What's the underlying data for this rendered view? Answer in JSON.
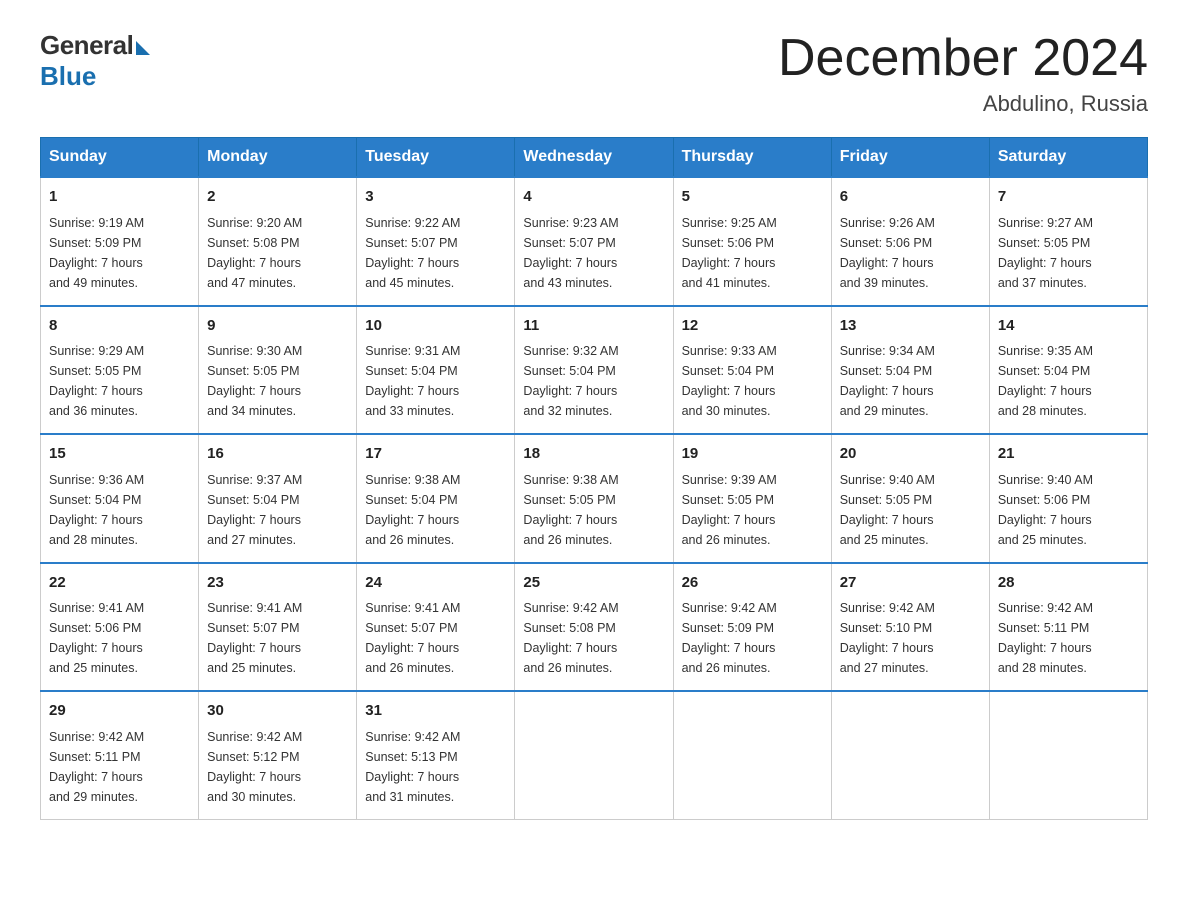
{
  "header": {
    "logo_general": "General",
    "logo_blue": "Blue",
    "month_title": "December 2024",
    "location": "Abdulino, Russia"
  },
  "weekdays": [
    "Sunday",
    "Monday",
    "Tuesday",
    "Wednesday",
    "Thursday",
    "Friday",
    "Saturday"
  ],
  "weeks": [
    [
      {
        "day": "1",
        "sunrise": "9:19 AM",
        "sunset": "5:09 PM",
        "daylight": "7 hours and 49 minutes."
      },
      {
        "day": "2",
        "sunrise": "9:20 AM",
        "sunset": "5:08 PM",
        "daylight": "7 hours and 47 minutes."
      },
      {
        "day": "3",
        "sunrise": "9:22 AM",
        "sunset": "5:07 PM",
        "daylight": "7 hours and 45 minutes."
      },
      {
        "day": "4",
        "sunrise": "9:23 AM",
        "sunset": "5:07 PM",
        "daylight": "7 hours and 43 minutes."
      },
      {
        "day": "5",
        "sunrise": "9:25 AM",
        "sunset": "5:06 PM",
        "daylight": "7 hours and 41 minutes."
      },
      {
        "day": "6",
        "sunrise": "9:26 AM",
        "sunset": "5:06 PM",
        "daylight": "7 hours and 39 minutes."
      },
      {
        "day": "7",
        "sunrise": "9:27 AM",
        "sunset": "5:05 PM",
        "daylight": "7 hours and 37 minutes."
      }
    ],
    [
      {
        "day": "8",
        "sunrise": "9:29 AM",
        "sunset": "5:05 PM",
        "daylight": "7 hours and 36 minutes."
      },
      {
        "day": "9",
        "sunrise": "9:30 AM",
        "sunset": "5:05 PM",
        "daylight": "7 hours and 34 minutes."
      },
      {
        "day": "10",
        "sunrise": "9:31 AM",
        "sunset": "5:04 PM",
        "daylight": "7 hours and 33 minutes."
      },
      {
        "day": "11",
        "sunrise": "9:32 AM",
        "sunset": "5:04 PM",
        "daylight": "7 hours and 32 minutes."
      },
      {
        "day": "12",
        "sunrise": "9:33 AM",
        "sunset": "5:04 PM",
        "daylight": "7 hours and 30 minutes."
      },
      {
        "day": "13",
        "sunrise": "9:34 AM",
        "sunset": "5:04 PM",
        "daylight": "7 hours and 29 minutes."
      },
      {
        "day": "14",
        "sunrise": "9:35 AM",
        "sunset": "5:04 PM",
        "daylight": "7 hours and 28 minutes."
      }
    ],
    [
      {
        "day": "15",
        "sunrise": "9:36 AM",
        "sunset": "5:04 PM",
        "daylight": "7 hours and 28 minutes."
      },
      {
        "day": "16",
        "sunrise": "9:37 AM",
        "sunset": "5:04 PM",
        "daylight": "7 hours and 27 minutes."
      },
      {
        "day": "17",
        "sunrise": "9:38 AM",
        "sunset": "5:04 PM",
        "daylight": "7 hours and 26 minutes."
      },
      {
        "day": "18",
        "sunrise": "9:38 AM",
        "sunset": "5:05 PM",
        "daylight": "7 hours and 26 minutes."
      },
      {
        "day": "19",
        "sunrise": "9:39 AM",
        "sunset": "5:05 PM",
        "daylight": "7 hours and 26 minutes."
      },
      {
        "day": "20",
        "sunrise": "9:40 AM",
        "sunset": "5:05 PM",
        "daylight": "7 hours and 25 minutes."
      },
      {
        "day": "21",
        "sunrise": "9:40 AM",
        "sunset": "5:06 PM",
        "daylight": "7 hours and 25 minutes."
      }
    ],
    [
      {
        "day": "22",
        "sunrise": "9:41 AM",
        "sunset": "5:06 PM",
        "daylight": "7 hours and 25 minutes."
      },
      {
        "day": "23",
        "sunrise": "9:41 AM",
        "sunset": "5:07 PM",
        "daylight": "7 hours and 25 minutes."
      },
      {
        "day": "24",
        "sunrise": "9:41 AM",
        "sunset": "5:07 PM",
        "daylight": "7 hours and 26 minutes."
      },
      {
        "day": "25",
        "sunrise": "9:42 AM",
        "sunset": "5:08 PM",
        "daylight": "7 hours and 26 minutes."
      },
      {
        "day": "26",
        "sunrise": "9:42 AM",
        "sunset": "5:09 PM",
        "daylight": "7 hours and 26 minutes."
      },
      {
        "day": "27",
        "sunrise": "9:42 AM",
        "sunset": "5:10 PM",
        "daylight": "7 hours and 27 minutes."
      },
      {
        "day": "28",
        "sunrise": "9:42 AM",
        "sunset": "5:11 PM",
        "daylight": "7 hours and 28 minutes."
      }
    ],
    [
      {
        "day": "29",
        "sunrise": "9:42 AM",
        "sunset": "5:11 PM",
        "daylight": "7 hours and 29 minutes."
      },
      {
        "day": "30",
        "sunrise": "9:42 AM",
        "sunset": "5:12 PM",
        "daylight": "7 hours and 30 minutes."
      },
      {
        "day": "31",
        "sunrise": "9:42 AM",
        "sunset": "5:13 PM",
        "daylight": "7 hours and 31 minutes."
      },
      null,
      null,
      null,
      null
    ]
  ],
  "labels": {
    "sunrise": "Sunrise:",
    "sunset": "Sunset:",
    "daylight": "Daylight:"
  }
}
